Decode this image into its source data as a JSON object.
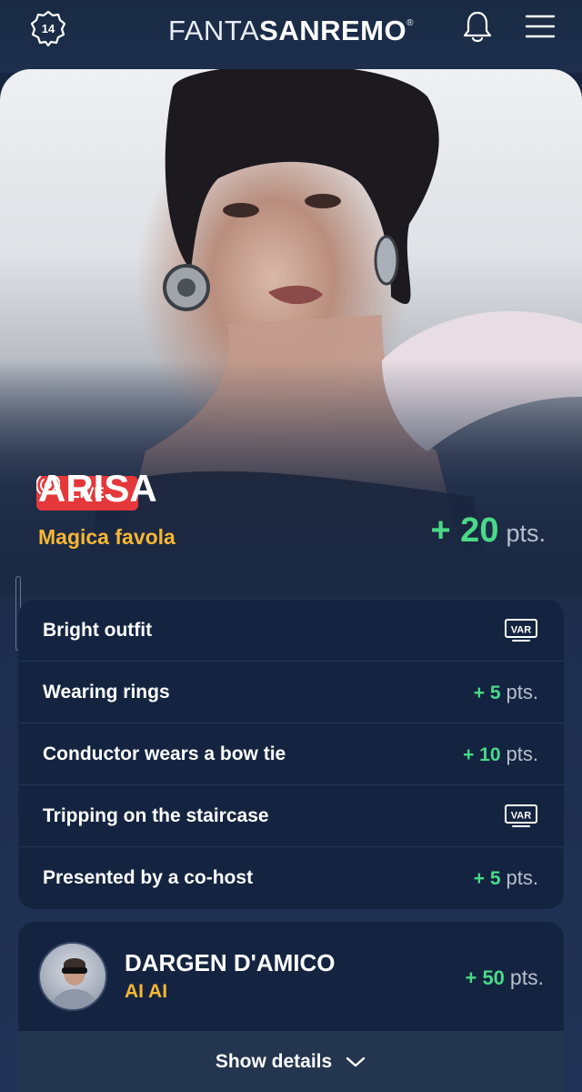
{
  "header": {
    "badge_number": "14",
    "logo_thin": "FANTA",
    "logo_bold": "SANREMO",
    "logo_mark": "®",
    "icons": [
      "badge-icon",
      "bell-icon",
      "menu-icon"
    ]
  },
  "hero": {
    "live_label": "LIVE",
    "artist": "ARISA",
    "song": "Magica favola",
    "points_value": "+ 20",
    "points_unit": "pts."
  },
  "bonuses": [
    {
      "label": "Bright outfit",
      "type": "var",
      "icon": "var-icon",
      "var_text": "VAR"
    },
    {
      "label": "Wearing rings",
      "type": "points",
      "value": "+ 5",
      "unit": "pts."
    },
    {
      "label": "Conductor wears a bow tie",
      "type": "points",
      "value": "+ 10",
      "unit": "pts."
    },
    {
      "label": "Tripping on the staircase",
      "type": "var",
      "icon": "var-icon",
      "var_text": "VAR"
    },
    {
      "label": "Presented by a co-host",
      "type": "points",
      "value": "+ 5",
      "unit": "pts."
    }
  ],
  "next_artist": {
    "artist": "DARGEN D'AMICO",
    "song": "AI AI",
    "points_value": "+ 50",
    "points_unit": "pts.",
    "show_details_label": "Show details"
  },
  "colors": {
    "accent_yellow": "#f7b733",
    "points_green": "#4ad987",
    "live_red": "#e5383b",
    "card_bg": "#142440"
  }
}
